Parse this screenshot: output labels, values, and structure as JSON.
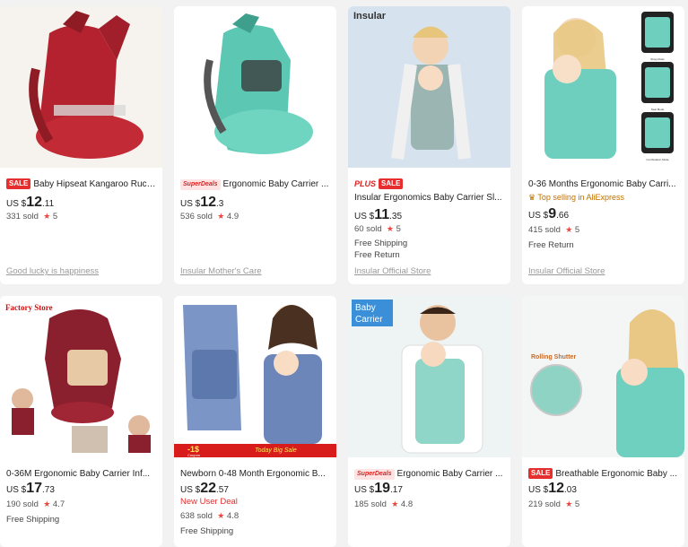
{
  "products": [
    {
      "badge": "SALE",
      "badge_type": "sale",
      "title": "Baby Hipseat Kangaroo Ruck...",
      "currency": "US $",
      "price_int": "12",
      "price_dec": ".11",
      "sold": "331 sold",
      "rating": "5",
      "extras": [],
      "store": "Good lucky is happiness"
    },
    {
      "badge": "SuperDeals",
      "badge_type": "super",
      "title": "Ergonomic Baby Carrier ...",
      "currency": "US $",
      "price_int": "12",
      "price_dec": ".3",
      "sold": "536 sold",
      "rating": "4.9",
      "extras": [],
      "store": "Insular Mother's Care"
    },
    {
      "badge": "PLUS",
      "badge2": "SALE",
      "badge_type": "plus",
      "title": "Insular Ergonomics Baby Carrier Sl...",
      "currency": "US $",
      "price_int": "11",
      "price_dec": ".35",
      "sold": "60 sold",
      "rating": "5",
      "extras": [
        "Free Shipping",
        "Free Return"
      ],
      "store": "Insular Official Store",
      "image_text": "Insular"
    },
    {
      "badge": "",
      "badge_type": "none",
      "title": "0-36 Months Ergonomic Baby Carri...",
      "top_selling": "Top selling in AliExpress",
      "currency": "US $",
      "price_int": "9",
      "price_dec": ".66",
      "sold": "415 sold",
      "rating": "5",
      "extras": [
        "Free Return"
      ],
      "store": "Insular Official Store",
      "image_text": [
        "Strap Mode",
        "Seat Mode",
        "Combination Mode"
      ]
    },
    {
      "badge": "",
      "badge_type": "none",
      "title": "0-36M Ergonomic Baby Carrier Inf...",
      "currency": "US $",
      "price_int": "17",
      "price_dec": ".73",
      "sold": "190 sold",
      "rating": "4.7",
      "extras": [
        "Free Shipping"
      ],
      "image_text": "Factory Store"
    },
    {
      "badge": "",
      "badge_type": "none",
      "title": "Newborn 0-48 Month Ergonomic B...",
      "currency": "US $",
      "price_int": "22",
      "price_dec": ".57",
      "new_user": "New User Deal",
      "sold": "638 sold",
      "rating": "4.8",
      "extras": [
        "Free Shipping"
      ],
      "image_text": [
        "-1$",
        "Coupon",
        "Today Big Sale"
      ]
    },
    {
      "badge": "SuperDeals",
      "badge_type": "super",
      "title": "Ergonomic Baby Carrier ...",
      "currency": "US $",
      "price_int": "19",
      "price_dec": ".17",
      "sold": "185 sold",
      "rating": "4.8",
      "extras": [],
      "image_text": [
        "Baby",
        "Carrier"
      ]
    },
    {
      "badge": "SALE",
      "badge_type": "sale",
      "title": "Breathable Ergonomic Baby ...",
      "currency": "US $",
      "price_int": "12",
      "price_dec": ".03",
      "sold": "219 sold",
      "rating": "5",
      "extras": [],
      "image_text": "Rolling Shutter"
    }
  ],
  "colors": {
    "page_bg": "#f2f2f2",
    "sale_red": "#e62e2e",
    "star": "#f0453a",
    "store_gray": "#999999"
  },
  "icons": {
    "star": "star-icon",
    "crown": "crown-icon"
  }
}
